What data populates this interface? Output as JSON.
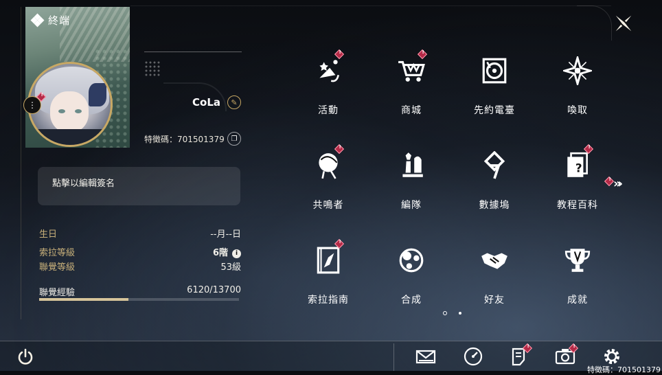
{
  "window": {
    "title": "終端"
  },
  "profile": {
    "player_name": "CoLa",
    "id_text": "特徵碼：701501379",
    "signature_placeholder": "點擊以編輯簽名"
  },
  "stats": {
    "birthday_label": "生日",
    "birthday_value": "--月--日",
    "sola_level_label": "索拉等級",
    "sola_level_value": "6階",
    "union_level_label": "聯覺等級",
    "union_level_value": "53級",
    "union_exp_label": "聯覺經驗",
    "union_exp_value": "6120/13700",
    "union_exp_fraction": 0.4467
  },
  "features": [
    {
      "label": "活動",
      "icon": "event-party-icon",
      "badge": true
    },
    {
      "label": "商城",
      "icon": "shopping-cart-icon",
      "badge": true
    },
    {
      "label": "先約電臺",
      "icon": "radio-turntable-icon",
      "badge": false
    },
    {
      "label": "喚取",
      "icon": "compass-star-icon",
      "badge": false
    },
    {
      "label": "共鳴者",
      "icon": "resonator-head-icon",
      "badge": true
    },
    {
      "label": "編隊",
      "icon": "team-chess-icon",
      "badge": false
    },
    {
      "label": "數據塢",
      "icon": "data-bank-icon",
      "badge": false
    },
    {
      "label": "教程百科",
      "icon": "tutorial-book-icon",
      "badge": true
    },
    {
      "label": "索拉指南",
      "icon": "guide-compass-book-icon",
      "badge": true
    },
    {
      "label": "合成",
      "icon": "synthesis-orbs-icon",
      "badge": false
    },
    {
      "label": "好友",
      "icon": "handshake-icon",
      "badge": false
    },
    {
      "label": "成就",
      "icon": "trophy-icon",
      "badge": false
    }
  ],
  "pagination": {
    "current": 1,
    "total": 2
  },
  "bottom_bar": {
    "items": [
      "power-icon",
      "mail-icon",
      "clock-icon",
      "notice-icon",
      "camera-icon",
      "settings-icon"
    ],
    "footer_id": "特徵碼：701501379"
  },
  "colors": {
    "accent_gold": "#c8a864",
    "badge_red": "#b52a47",
    "label_gold": "#c8b07a"
  }
}
